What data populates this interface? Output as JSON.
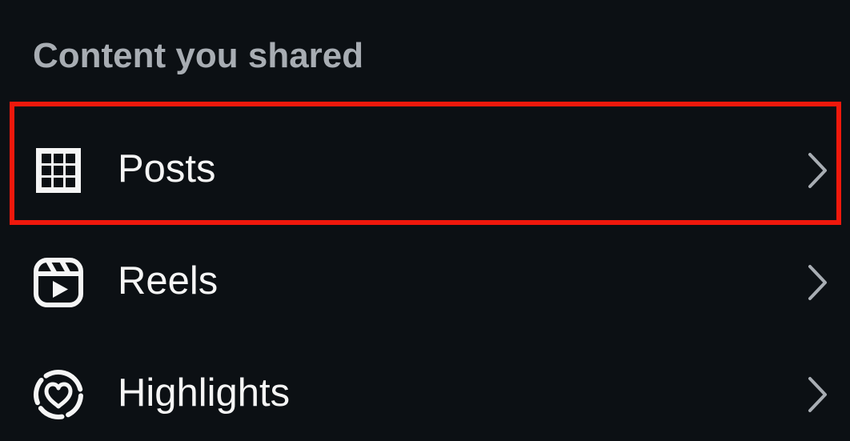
{
  "section": {
    "title": "Content you shared"
  },
  "items": [
    {
      "label": "Posts",
      "icon": "grid-icon",
      "chevron": "chevron-right-icon"
    },
    {
      "label": "Reels",
      "icon": "reels-icon",
      "chevron": "chevron-right-icon"
    },
    {
      "label": "Highlights",
      "icon": "highlights-icon",
      "chevron": "chevron-right-icon"
    }
  ],
  "colors": {
    "background": "#0c1014",
    "header_text": "#a8adb3",
    "item_text": "#f5f5f5",
    "chevron": "#a8adb3",
    "highlight_border": "#f0180c"
  }
}
